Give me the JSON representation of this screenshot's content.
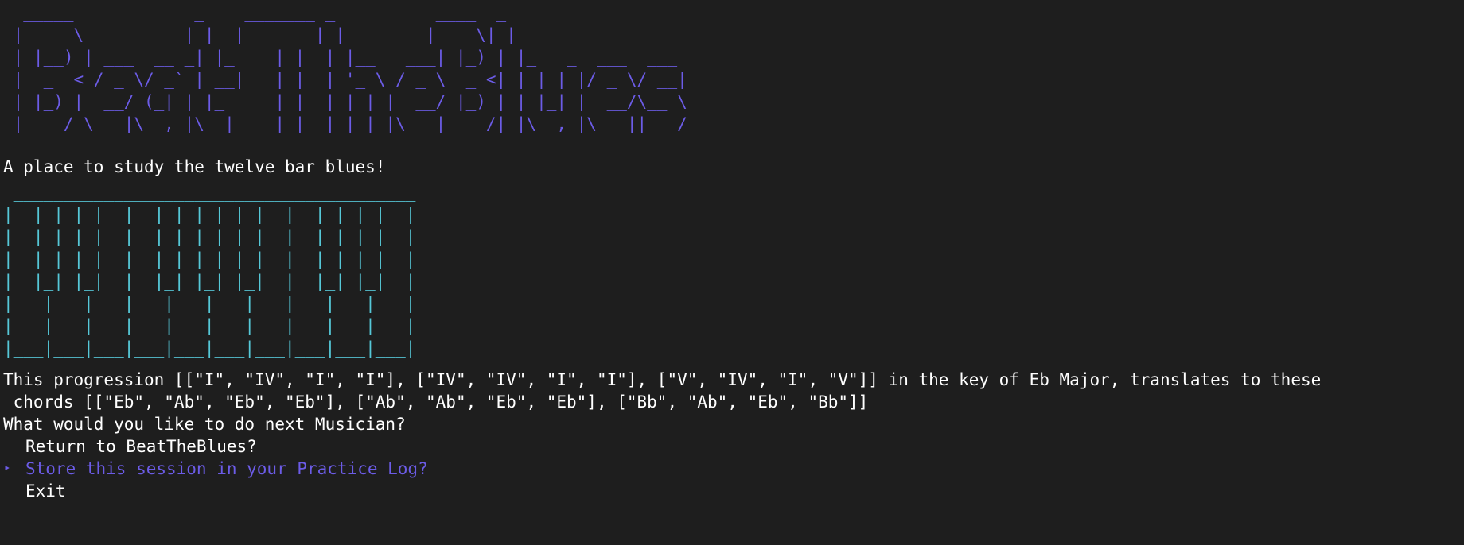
{
  "banner_art": "  _____            _    _______ _          ____  _\n |  __ \\          | |  |__   __| |        |  _ \\| |\n | |__) | ___  __ _| |_    | |  | |__   ___| |_) | |_   _  ___  ___\n |  _  < / _ \\/ _` | __|   | |  | '_ \\ / _ \\  _ <| | | | |/ _ \\/ __|\n | |_) |  __/ (_| | |_     | |  | | | |  __/ |_) | | |_| |  __/\\__ \\\n |____/ \\___|\\__,_|\\__|    |_|  |_| |_|\\___|____/|_|\\__,_|\\___||___/",
  "tagline": "A place to study the twelve bar blues!",
  "piano_art": " ________________________________________\n|  | | | |  |  | | | | | |  |  | | | |  |\n|  | | | |  |  | | | | | |  |  | | | |  |\n|  | | | |  |  | | | | | |  |  | | | |  |\n|  |_| |_|  |  |_| |_| |_|  |  |_| |_|  |\n|   |   |   |   |   |   |   |   |   |   |\n|   |   |   |   |   |   |   |   |   |   |\n|___|___|___|___|___|___|___|___|___|___|",
  "progression": {
    "line1": "This progression [[\"I\", \"IV\", \"I\", \"I\"], [\"IV\", \"IV\", \"I\", \"I\"], [\"V\", \"IV\", \"I\", \"V\"]] in the key of Eb Major, translates to these",
    "line2": " chords [[\"Eb\", \"Ab\", \"Eb\", \"Eb\"], [\"Ab\", \"Ab\", \"Eb\", \"Eb\"], [\"Bb\", \"Ab\", \"Eb\", \"Bb\"]]"
  },
  "prompt": "What would you like to do next Musician?",
  "menu": {
    "selected_pointer": "‣",
    "items": [
      {
        "label": "Return to BeatTheBlues?"
      },
      {
        "label": "Store this session in your Practice Log?"
      },
      {
        "label": "Exit"
      }
    ]
  },
  "colors": {
    "background": "#1e1e1e",
    "accent": "#6c5ce7",
    "piano": "#56c8d8",
    "text": "#ffffff"
  }
}
